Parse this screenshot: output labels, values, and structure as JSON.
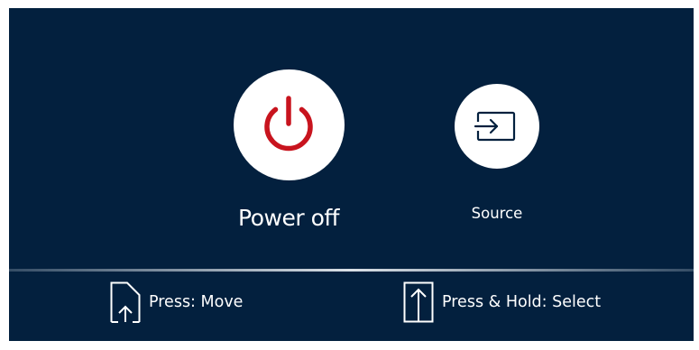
{
  "menu": {
    "items": [
      {
        "label": "Power off",
        "icon": "power-icon",
        "icon_color": "#c8141e",
        "selected": true
      },
      {
        "label": "Source",
        "icon": "source-input-icon",
        "icon_color": "#03203e",
        "selected": false
      }
    ]
  },
  "hints": [
    {
      "icon": "press-move-icon",
      "label": "Press: Move"
    },
    {
      "icon": "press-hold-select-icon",
      "label": "Press & Hold: Select"
    }
  ],
  "colors": {
    "background": "#03203e",
    "circle": "#ffffff",
    "text": "#ffffff",
    "power_accent": "#c8141e"
  }
}
